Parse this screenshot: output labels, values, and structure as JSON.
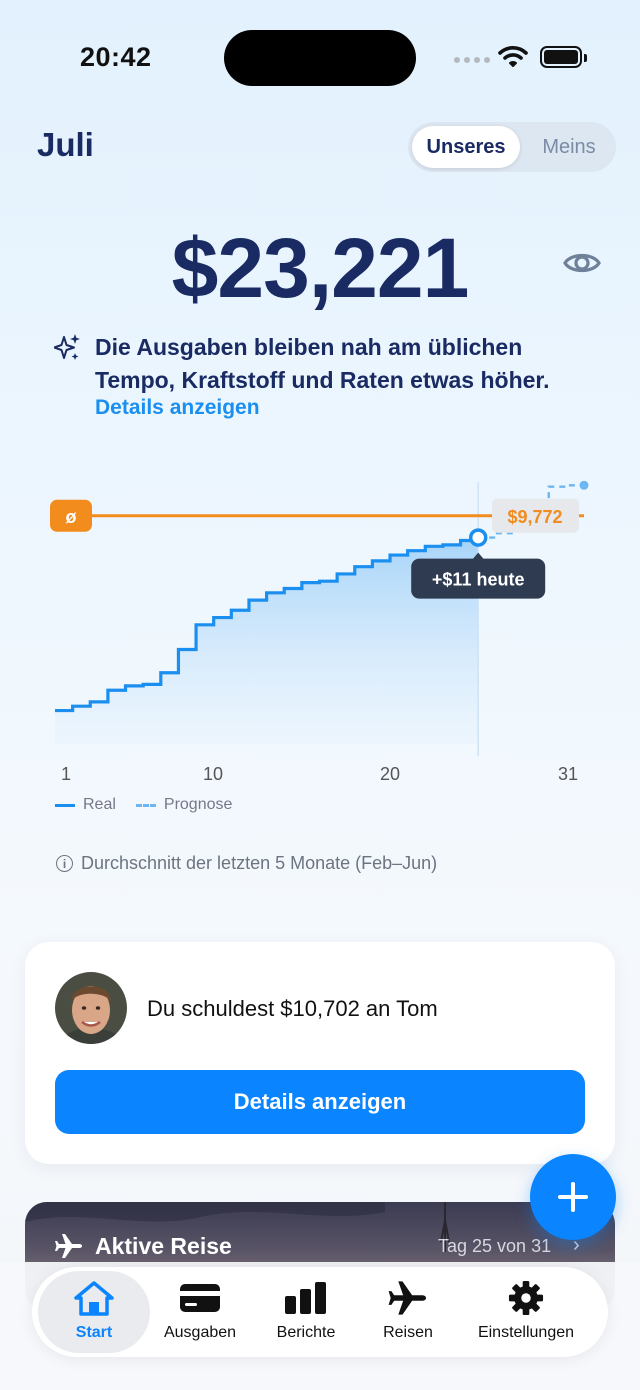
{
  "status_bar": {
    "time": "20:42"
  },
  "header": {
    "month": "Juli",
    "toggle": {
      "selected": "Unseres",
      "other": "Meins"
    }
  },
  "summary": {
    "amount": "$23,221",
    "insight": "Die Ausgaben bleiben nah am üblichen Tempo, Kraftstoff und Raten etwas höher.",
    "details_link": "Details anzeigen"
  },
  "chart_data": {
    "type": "area",
    "x_ticks": [
      "1",
      "10",
      "20",
      "31"
    ],
    "avg_marker": "ø",
    "avg_value_label": "$9,772",
    "today_tooltip": "+$11 heute",
    "legend": {
      "real": "Real",
      "forecast": "Prognose"
    },
    "real": {
      "x": [
        1,
        2,
        3,
        4,
        5,
        6,
        7,
        8,
        9,
        10,
        11,
        12,
        13,
        14,
        15,
        16,
        17,
        18,
        19,
        20,
        21,
        22,
        23,
        24,
        25
      ],
      "y": [
        7000,
        7300,
        7600,
        8400,
        8700,
        8800,
        9600,
        11200,
        12900,
        13400,
        13900,
        14600,
        15100,
        15400,
        15800,
        15900,
        16400,
        16900,
        17300,
        17700,
        18000,
        18300,
        18400,
        18700,
        18900
      ]
    },
    "forecast": {
      "x": [
        25,
        26,
        27,
        28,
        29,
        30,
        31
      ],
      "y": [
        18900,
        19200,
        19800,
        20500,
        22400,
        22500,
        22500
      ]
    },
    "average": 20400,
    "today": 25,
    "xlim": [
      1,
      31
    ],
    "ylim": [
      4700,
      23000
    ],
    "note": "Durchschnitt der letzten 5 Monate (Feb–Jun)"
  },
  "debt_card": {
    "text": "Du schuldest $10,702 an Tom",
    "button": "Details anzeigen"
  },
  "trip_card": {
    "title": "Aktive Reise",
    "progress": "Tag 25 von 31"
  },
  "tabs": [
    {
      "label": "Start",
      "icon": "home-icon",
      "active": true
    },
    {
      "label": "Ausgaben",
      "icon": "card-icon",
      "active": false
    },
    {
      "label": "Berichte",
      "icon": "bar-chart-icon",
      "active": false
    },
    {
      "label": "Reisen",
      "icon": "airplane-icon",
      "active": false
    },
    {
      "label": "Einstellungen",
      "icon": "gear-icon",
      "active": false
    }
  ],
  "colors": {
    "accent": "#0a84ff",
    "average": "#f28c1c",
    "navy": "#1a2b63"
  }
}
